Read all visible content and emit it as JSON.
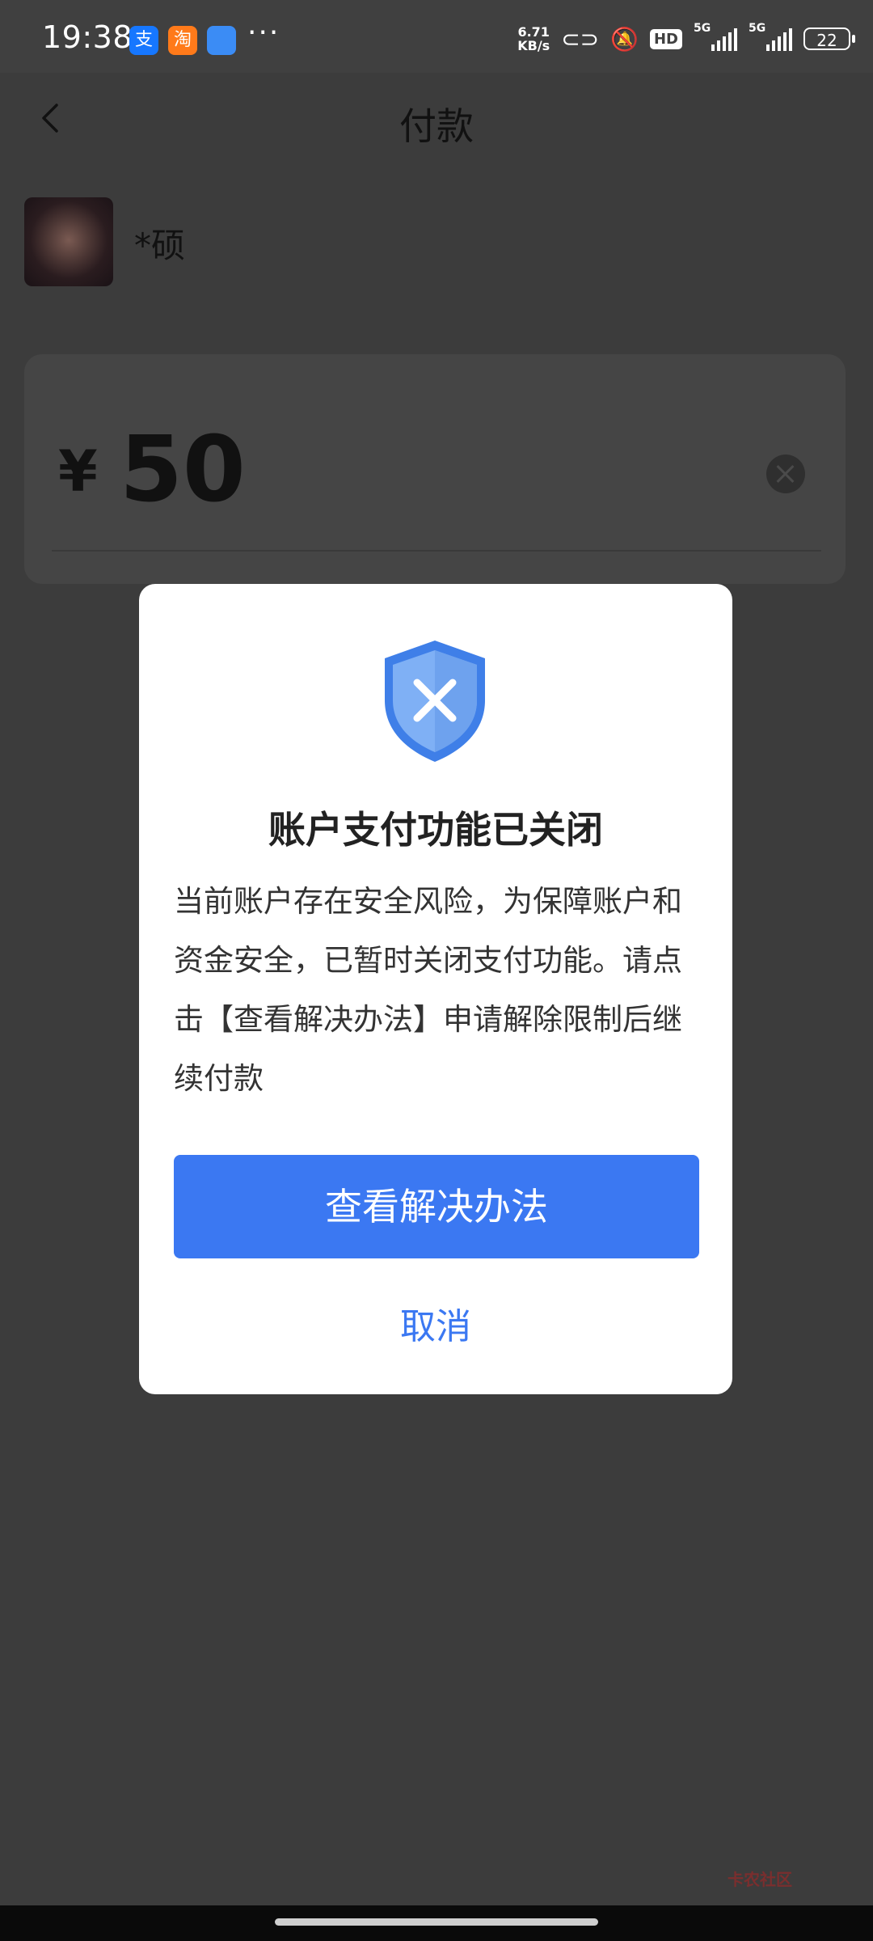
{
  "status": {
    "time": "19:38",
    "apps": [
      {
        "name": "alipay-icon",
        "glyph": "支",
        "color": "#1677ff"
      },
      {
        "name": "taobao-icon",
        "glyph": "淘",
        "color": "#ff7a1a"
      },
      {
        "name": "message-app-icon",
        "glyph": "",
        "color": "#3b8cf5"
      }
    ],
    "more": "···",
    "net_speed_value": "6.71",
    "net_speed_unit": "KB/s",
    "hd": "HD",
    "network_1": "5G",
    "network_2": "5G",
    "battery": "22"
  },
  "topbar": {
    "title": "付款"
  },
  "payee": {
    "name": "*硕"
  },
  "amount": {
    "currency": "¥",
    "value": "50"
  },
  "dialog": {
    "title": "账户支付功能已关闭",
    "body": "当前账户存在安全风险，为保障账户和资金安全，已暂时关闭支付功能。请点击【查看解决办法】申请解除限制后继续付款",
    "primary_button": "查看解决办法",
    "cancel_button": "取消"
  },
  "watermark": "卡农社区",
  "colors": {
    "accent": "#3b78f2",
    "overlay": "#3c3c3c",
    "dialog_bg": "#ffffff"
  }
}
